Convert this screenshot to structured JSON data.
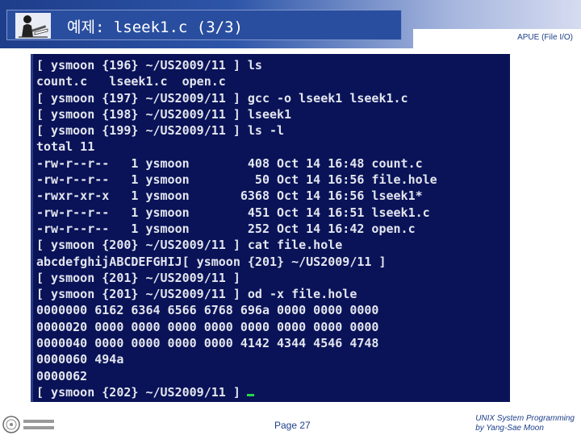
{
  "slide": {
    "title": "예제: lseek1.c (3/3)",
    "subject": "APUE (File I/O)",
    "page": "Page 27",
    "course": "UNIX System Programming",
    "author": "by Yang-Sae Moon"
  },
  "terminal": {
    "lines": [
      "[ ysmoon {196} ~/US2009/11 ] ls",
      "count.c   lseek1.c  open.c",
      "[ ysmoon {197} ~/US2009/11 ] gcc -o lseek1 lseek1.c",
      "[ ysmoon {198} ~/US2009/11 ] lseek1",
      "[ ysmoon {199} ~/US2009/11 ] ls -l",
      "total 11",
      "-rw-r--r--   1 ysmoon        408 Oct 14 16:48 count.c",
      "-rw-r--r--   1 ysmoon         50 Oct 14 16:56 file.hole",
      "-rwxr-xr-x   1 ysmoon       6368 Oct 14 16:56 lseek1*",
      "-rw-r--r--   1 ysmoon        451 Oct 14 16:51 lseek1.c",
      "-rw-r--r--   1 ysmoon        252 Oct 14 16:42 open.c",
      "[ ysmoon {200} ~/US2009/11 ] cat file.hole",
      "abcdefghijABCDEFGHIJ[ ysmoon {201} ~/US2009/11 ]",
      "[ ysmoon {201} ~/US2009/11 ]",
      "[ ysmoon {201} ~/US2009/11 ] od -x file.hole",
      "0000000 6162 6364 6566 6768 696a 0000 0000 0000",
      "0000020 0000 0000 0000 0000 0000 0000 0000 0000",
      "0000040 0000 0000 0000 0000 4142 4344 4546 4748",
      "0000060 494a",
      "0000062",
      "[ ysmoon {202} ~/US2009/11 ]"
    ]
  },
  "colors": {
    "terminal_bg": "#0a1358",
    "terminal_fg": "#e3e6ee",
    "cursor": "#25d84a",
    "title_band": "#2a4e9f",
    "accent_text": "#1d3f8a"
  },
  "icons": {
    "title_logo": "reading-person-logo",
    "footer_seal": "university-seal"
  }
}
